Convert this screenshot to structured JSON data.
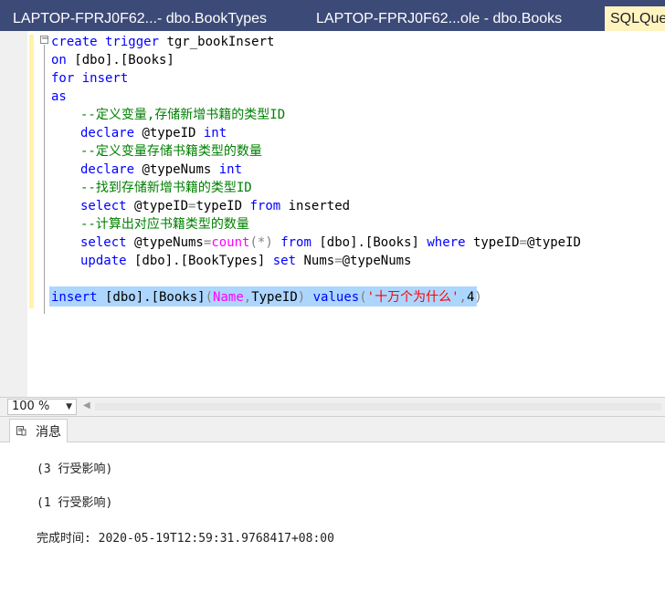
{
  "tabs": [
    {
      "label": "LAPTOP-FPRJ0F62...- dbo.BookTypes"
    },
    {
      "label": "LAPTOP-FPRJ0F62...ole - dbo.Books"
    },
    {
      "label": "SQLQue"
    }
  ],
  "code": {
    "l1": {
      "a": "create trigger",
      "b": " tgr_bookInsert"
    },
    "l2": {
      "a": "on",
      "b": " [dbo].[Books]"
    },
    "l3": {
      "a": "for insert"
    },
    "l4": {
      "a": "as"
    },
    "l5": {
      "a": "--定义变量,存储新增书籍的类型ID"
    },
    "l6": {
      "a": "declare",
      "b": " @typeID ",
      "c": "int"
    },
    "l7": {
      "a": "--定义变量存储书籍类型的数量"
    },
    "l8": {
      "a": "declare",
      "b": " @typeNums ",
      "c": "int"
    },
    "l9": {
      "a": "--找到存储新增书籍的类型ID"
    },
    "l10": {
      "a": "select",
      "b": " @typeID",
      "c": "=",
      "d": "typeID ",
      "e": "from",
      "f": " inserted"
    },
    "l11": {
      "a": "--计算出对应书籍类型的数量"
    },
    "l12": {
      "a": "select",
      "b": " @typeNums",
      "c": "=",
      "d": "count",
      "e": "(*)",
      "f": " from",
      "g": " [dbo].[Books] ",
      "h": "where",
      "i": " typeID",
      "j": "=",
      "k": "@typeID"
    },
    "l13": {
      "a": "update",
      "b": " [dbo].[BookTypes] ",
      "c": "set",
      "d": " Nums",
      "e": "=",
      "f": "@typeNums"
    },
    "l14": {
      "a": "insert",
      "b": " [dbo].[Books]",
      "c": "(",
      "d": "Name",
      "e": ",",
      "f": "TypeID",
      "g": ") ",
      "h": "values",
      "i": "(",
      "j": "'十万个为什么'",
      "k": ",",
      "l": "4",
      "m": ")"
    }
  },
  "zoom": {
    "value": "100 %"
  },
  "results": {
    "tab_label": "消息",
    "messages": [
      "(3 行受影响)",
      "(1 行受影响)",
      "完成时间: 2020-05-19T12:59:31.9768417+08:00"
    ]
  }
}
